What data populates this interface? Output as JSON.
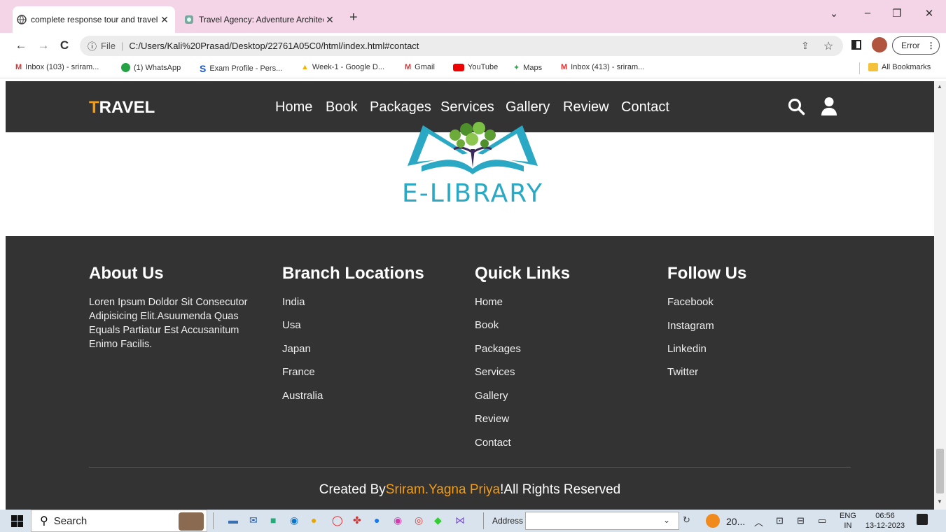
{
  "browser": {
    "tabs": [
      {
        "title": "complete response tour and travel",
        "active": true
      },
      {
        "title": "Travel Agency: Adventure Architect",
        "active": false
      }
    ],
    "url_scheme": "File",
    "url": "C:/Users/Kali%20Prasad/Desktop/22761A05C0/html/index.html#contact",
    "error_label": "Error",
    "bookmarks": [
      {
        "label": "Inbox (103) - sriram...",
        "icon": "gmail-icon"
      },
      {
        "label": "(1) WhatsApp",
        "icon": "whatsapp-icon"
      },
      {
        "label": "Exam Profile - Pers...",
        "icon": "exam-icon"
      },
      {
        "label": "Week-1 - Google D...",
        "icon": "drive-icon"
      },
      {
        "label": "Gmail",
        "icon": "gmail-icon"
      },
      {
        "label": "YouTube",
        "icon": "youtube-icon"
      },
      {
        "label": "Maps",
        "icon": "maps-icon"
      },
      {
        "label": "Inbox (413) - sriram...",
        "icon": "gmail-icon"
      }
    ],
    "all_bookmarks": "All Bookmarks"
  },
  "site": {
    "brand_first": "T",
    "brand_rest": "RAVEL",
    "nav": [
      "Home",
      "Book",
      "Packages",
      "Services",
      "Gallery",
      "Review",
      "Contact"
    ],
    "logo_text": "E-LIBRARY",
    "colors": {
      "accent": "#f39c12",
      "dark": "#333333",
      "logo": "#2aa8c4"
    }
  },
  "footer": {
    "about": {
      "heading": "About Us",
      "text": "Loren Ipsum Doldor Sit Consecutor Adipisicing Elit.Asuumenda Quas Equals Partiatur Est Accusanitum Enimo Facilis."
    },
    "branches": {
      "heading": "Branch Locations",
      "items": [
        "India",
        "Usa",
        "Japan",
        "France",
        "Australia"
      ]
    },
    "quick": {
      "heading": "Quick Links",
      "items": [
        "Home",
        "Book",
        "Packages",
        "Services",
        "Gallery",
        "Review",
        "Contact"
      ]
    },
    "follow": {
      "heading": "Follow Us",
      "items": [
        "Facebook",
        "Instagram",
        "Linkedin",
        "Twitter"
      ]
    },
    "credit": {
      "prefix": "Created By",
      "author": "Sriram.Yagna Priya",
      "suffix": "!All Rights Reserved"
    }
  },
  "taskbar": {
    "search": "Search",
    "address_label": "Address",
    "weather": "20...",
    "lang_top": "ENG",
    "lang_bottom": "IN",
    "time": "06:56",
    "date": "13-12-2023"
  }
}
